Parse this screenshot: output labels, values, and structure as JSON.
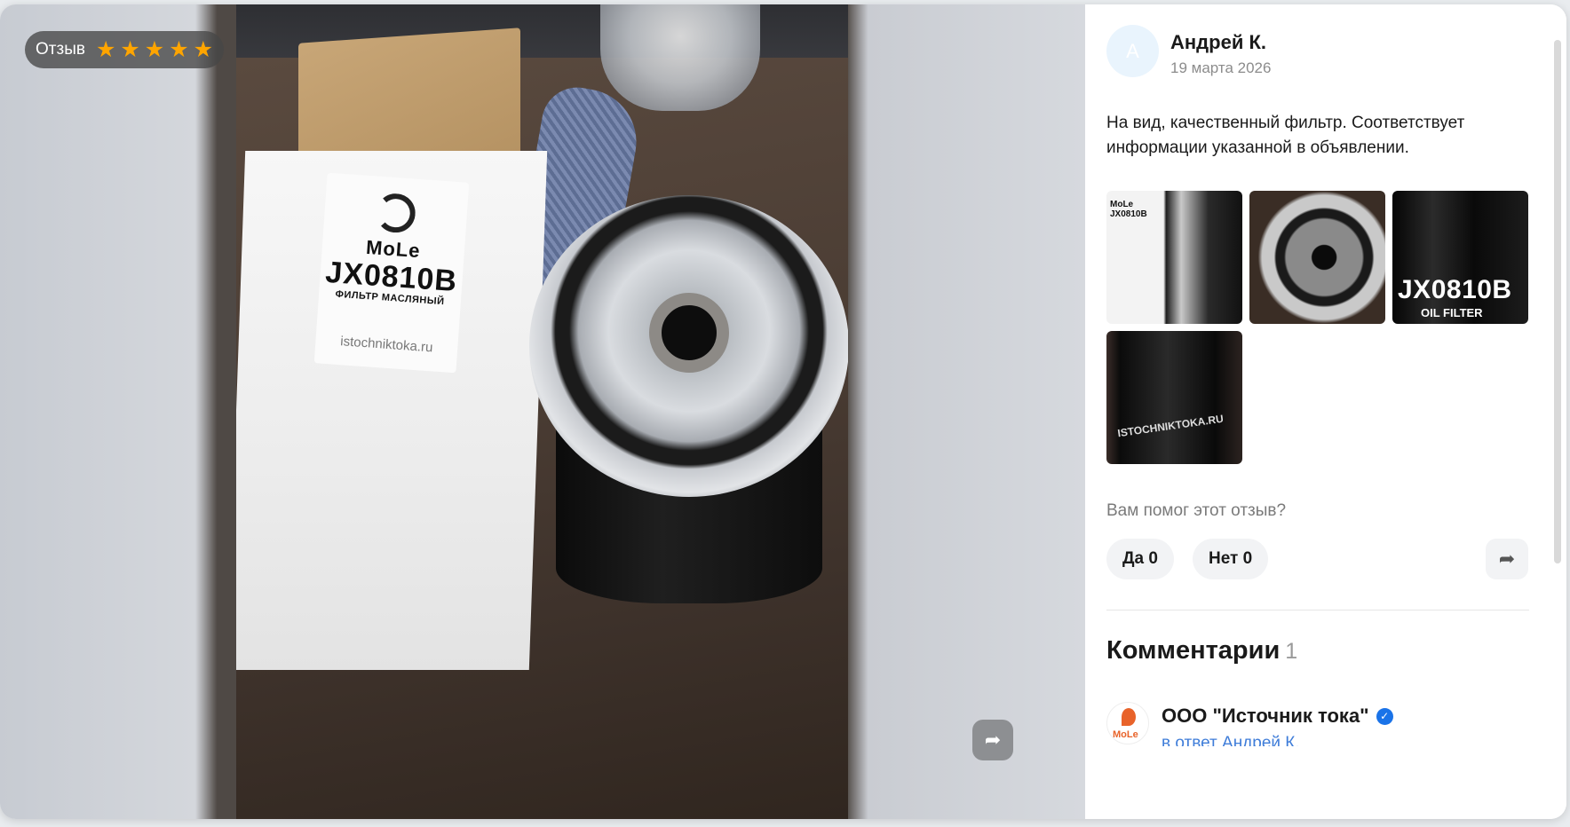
{
  "viewer": {
    "badge_label": "Отзыв",
    "rating": 5,
    "photo_label": {
      "brand": "MoLe",
      "code": "JX0810B",
      "subtitle": "ФИЛЬТР МАСЛЯНЫЙ",
      "site": "istochniktoka.ru"
    },
    "share_icon": "share-arrow-icon"
  },
  "review": {
    "avatar_letter": "А",
    "author": "Андрей К.",
    "date": "19 марта 2026",
    "text": "На вид, качественный фильтр. Соответствует информации указанной в объявлении.",
    "thumbnails": [
      {
        "text": "MoLe JX0810B"
      },
      {
        "text": ""
      },
      {
        "text": "JX0810B",
        "sub": "OIL FILTER"
      },
      {
        "text": "ISTOCHNIKTOKA.RU"
      }
    ],
    "helpful_question": "Вам помог этот отзыв?",
    "vote_yes": "Да 0",
    "vote_no": "Нет 0"
  },
  "comments": {
    "title": "Комментарии",
    "count": "1",
    "items": [
      {
        "avatar_text": "MoLe",
        "author": "ООО \"Источник тока\"",
        "reply_to": "в ответ Андрей К."
      }
    ]
  },
  "colors": {
    "star": "#ffa500",
    "link": "#3f7dd9",
    "verified": "#1a73e8"
  }
}
